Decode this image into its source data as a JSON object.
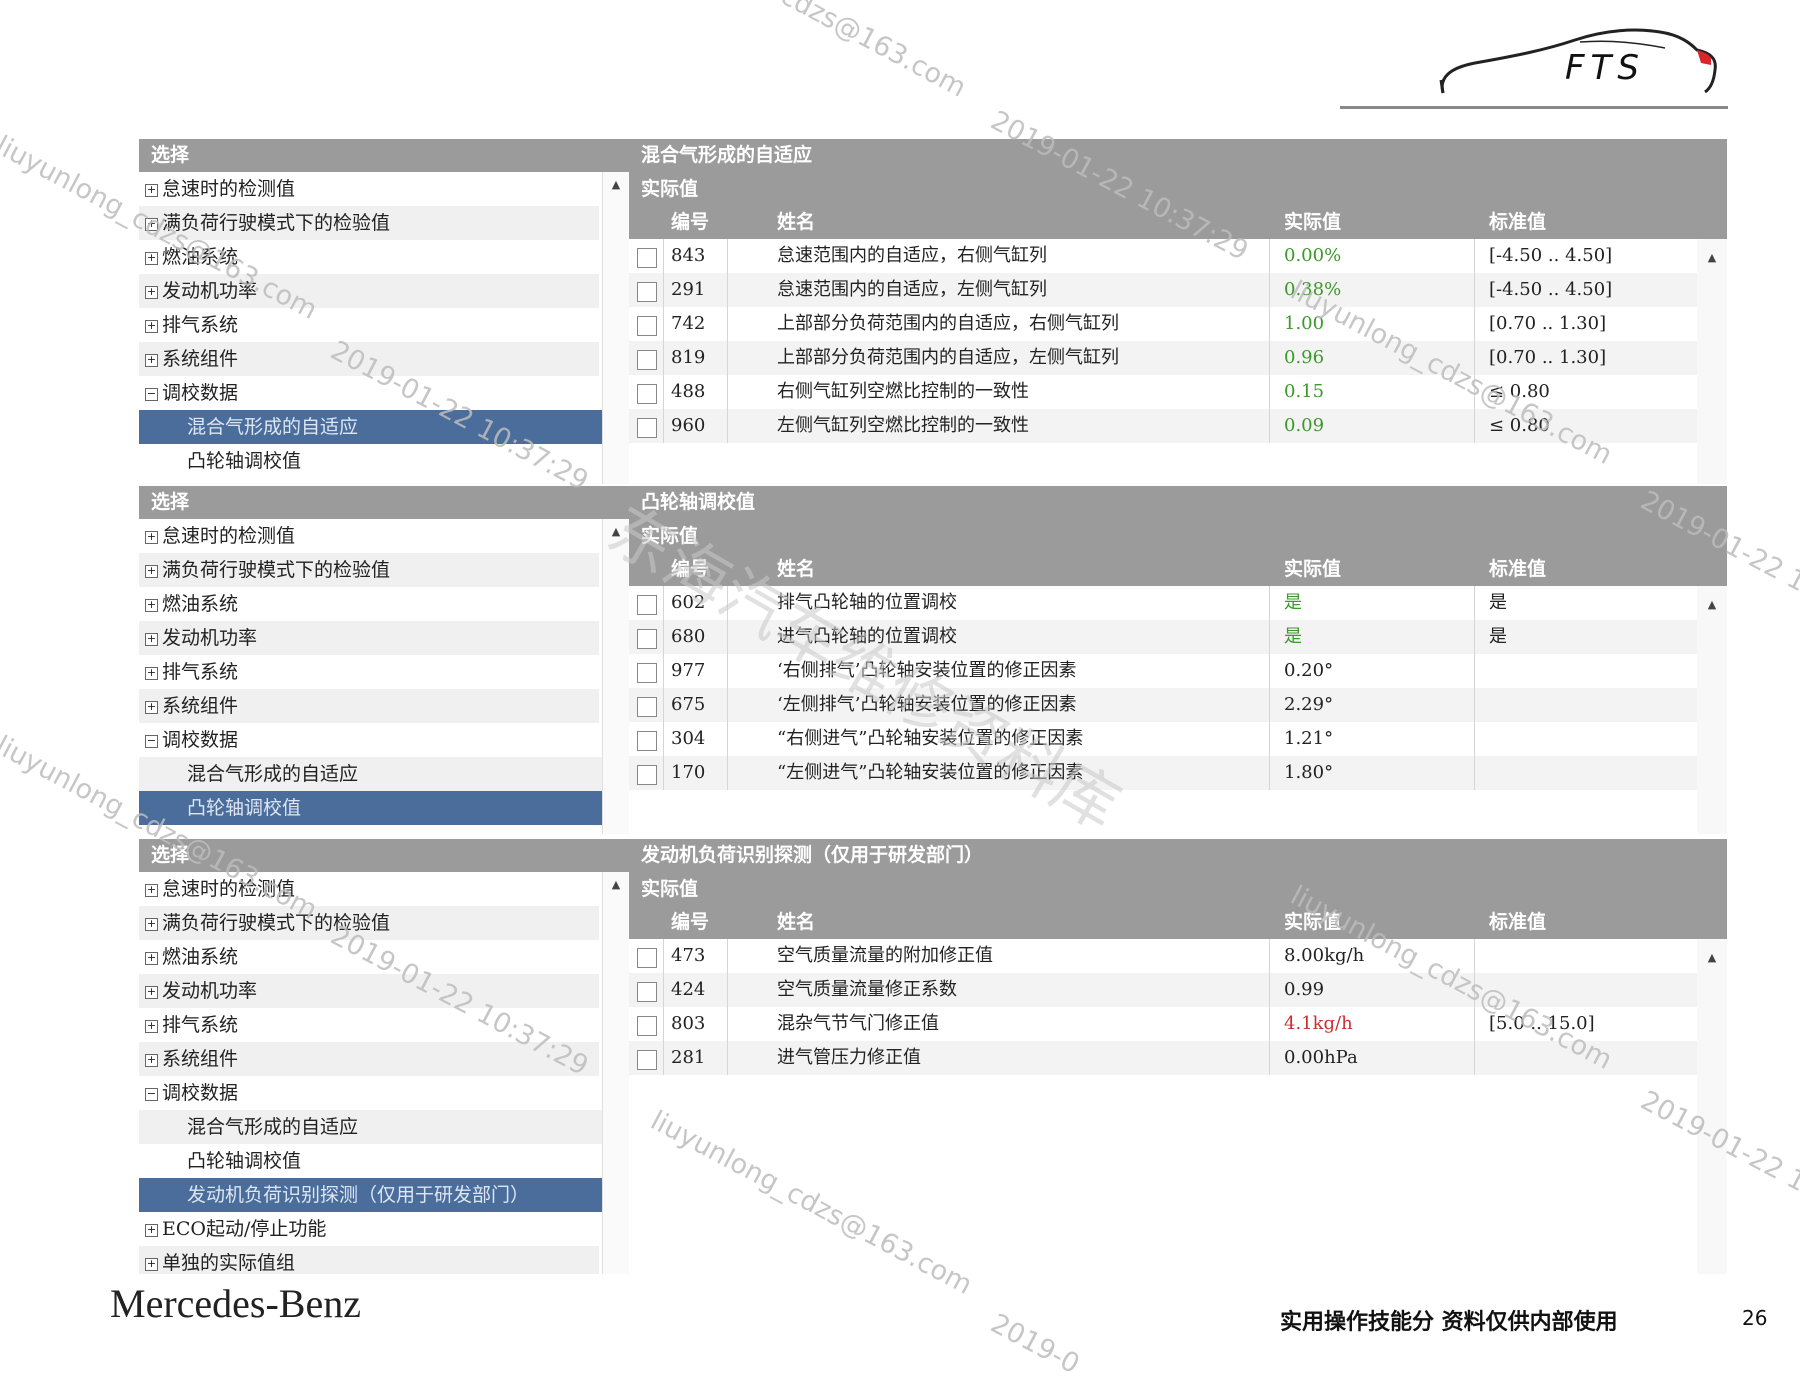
{
  "logo": {
    "text": "FTS"
  },
  "panels": [
    {
      "selection_header": "选择",
      "detail_title": "混合气形成的自适应",
      "detail_subtitle": "实际值",
      "columns": {
        "id": "编号",
        "name": "姓名",
        "actual": "实际值",
        "standard": "标准值"
      },
      "tree": [
        {
          "label": "怠速时的检测值",
          "icon": "plus-icon"
        },
        {
          "label": "满负荷行驶模式下的检验值",
          "icon": "plus-icon"
        },
        {
          "label": "燃油系统",
          "icon": "plus-icon"
        },
        {
          "label": "发动机功率",
          "icon": "plus-icon"
        },
        {
          "label": "排气系统",
          "icon": "plus-icon"
        },
        {
          "label": "系统组件",
          "icon": "plus-icon"
        },
        {
          "label": "调校数据",
          "icon": "minus-icon"
        },
        {
          "label": "混合气形成的自适应",
          "child": true,
          "selected": true
        },
        {
          "label": "凸轮轴调校值",
          "child": true
        }
      ],
      "rows": [
        {
          "id": "843",
          "name": "怠速范围内的自适应，右侧气缸列",
          "actual": "0.00%",
          "standard": "[-4.50 .. 4.50]",
          "status": "green"
        },
        {
          "id": "291",
          "name": "怠速范围内的自适应，左侧气缸列",
          "actual": "0.38%",
          "standard": "[-4.50 .. 4.50]",
          "status": "green"
        },
        {
          "id": "742",
          "name": "上部部分负荷范围内的自适应，右侧气缸列",
          "actual": "1.00",
          "standard": "[0.70 .. 1.30]",
          "status": "green"
        },
        {
          "id": "819",
          "name": "上部部分负荷范围内的自适应，左侧气缸列",
          "actual": "0.96",
          "standard": "[0.70 .. 1.30]",
          "status": "green"
        },
        {
          "id": "488",
          "name": "右侧气缸列空燃比控制的一致性",
          "actual": "0.15",
          "standard": "≤ 0.80",
          "status": "green"
        },
        {
          "id": "960",
          "name": "左侧气缸列空燃比控制的一致性",
          "actual": "0.09",
          "standard": "≤ 0.80",
          "status": "green"
        }
      ]
    },
    {
      "selection_header": "选择",
      "detail_title": "凸轮轴调校值",
      "detail_subtitle": "实际值",
      "columns": {
        "id": "编号",
        "name": "姓名",
        "actual": "实际值",
        "standard": "标准值"
      },
      "tree": [
        {
          "label": "怠速时的检测值",
          "icon": "plus-icon"
        },
        {
          "label": "满负荷行驶模式下的检验值",
          "icon": "plus-icon"
        },
        {
          "label": "燃油系统",
          "icon": "plus-icon"
        },
        {
          "label": "发动机功率",
          "icon": "plus-icon"
        },
        {
          "label": "排气系统",
          "icon": "plus-icon"
        },
        {
          "label": "系统组件",
          "icon": "plus-icon"
        },
        {
          "label": "调校数据",
          "icon": "minus-icon"
        },
        {
          "label": "混合气形成的自适应",
          "child": true
        },
        {
          "label": "凸轮轴调校值",
          "child": true,
          "selected": true
        }
      ],
      "rows": [
        {
          "id": "602",
          "name": "排气凸轮轴的位置调校",
          "actual": "是",
          "standard": "是",
          "status": "green"
        },
        {
          "id": "680",
          "name": "进气凸轮轴的位置调校",
          "actual": "是",
          "standard": "是",
          "status": "green"
        },
        {
          "id": "977",
          "name": "‘右侧排气’凸轮轴安装位置的修正因素",
          "actual": "0.20°",
          "standard": "",
          "status": "normal"
        },
        {
          "id": "675",
          "name": "‘左侧排气’凸轮轴安装位置的修正因素",
          "actual": "2.29°",
          "standard": "",
          "status": "normal"
        },
        {
          "id": "304",
          "name": "“右侧进气”凸轮轴安装位置的修正因素",
          "actual": "1.21°",
          "standard": "",
          "status": "normal"
        },
        {
          "id": "170",
          "name": "“左侧进气”凸轮轴安装位置的修正因素",
          "actual": "1.80°",
          "standard": "",
          "status": "normal"
        }
      ]
    },
    {
      "selection_header": "选择",
      "detail_title": "发动机负荷识别探测（仅用于研发部门）",
      "detail_subtitle": "实际值",
      "columns": {
        "id": "编号",
        "name": "姓名",
        "actual": "实际值",
        "standard": "标准值"
      },
      "tree": [
        {
          "label": "怠速时的检测值",
          "icon": "plus-icon"
        },
        {
          "label": "满负荷行驶模式下的检验值",
          "icon": "plus-icon"
        },
        {
          "label": "燃油系统",
          "icon": "plus-icon"
        },
        {
          "label": "发动机功率",
          "icon": "plus-icon"
        },
        {
          "label": "排气系统",
          "icon": "plus-icon"
        },
        {
          "label": "系统组件",
          "icon": "plus-icon"
        },
        {
          "label": "调校数据",
          "icon": "minus-icon"
        },
        {
          "label": "混合气形成的自适应",
          "child": true
        },
        {
          "label": "凸轮轴调校值",
          "child": true
        },
        {
          "label": "发动机负荷识别探测（仅用于研发部门）",
          "child": true,
          "selected": true
        },
        {
          "label": "ECO起动/停止功能",
          "icon": "plus-icon"
        },
        {
          "label": "单独的实际值组",
          "icon": "plus-icon"
        }
      ],
      "rows": [
        {
          "id": "473",
          "name": "空气质量流量的附加修正值",
          "actual": "8.00kg/h",
          "standard": "",
          "status": "normal"
        },
        {
          "id": "424",
          "name": "空气质量流量修正系数",
          "actual": "0.99",
          "standard": "",
          "status": "normal"
        },
        {
          "id": "803",
          "name": "混杂气节气门修正值",
          "actual": "4.1kg/h",
          "standard": "[5.0 .. 15.0]",
          "status": "red"
        },
        {
          "id": "281",
          "name": "进气管压力修正值",
          "actual": "0.00hPa",
          "standard": "",
          "status": "normal"
        }
      ]
    }
  ],
  "footer": {
    "brand": "Mercedes-Benz",
    "note": "实用操作技能分 资料仅供内部使用",
    "page_number": "26"
  },
  "watermarks": {
    "email": "liuyunlong_cdzs@163.com",
    "email_partial": "cdzs@163.com",
    "date": "2019-01-22 10:37:29",
    "date_partial": "2019-01-22 1",
    "date_tail": "2019-0",
    "cn": "东海汽车维修资料库"
  },
  "colors": {
    "header_gray": "#9b9b9b",
    "selected_blue": "#4a6d9b",
    "ok_green": "#3c9a2a",
    "alert_red": "#c83030"
  }
}
